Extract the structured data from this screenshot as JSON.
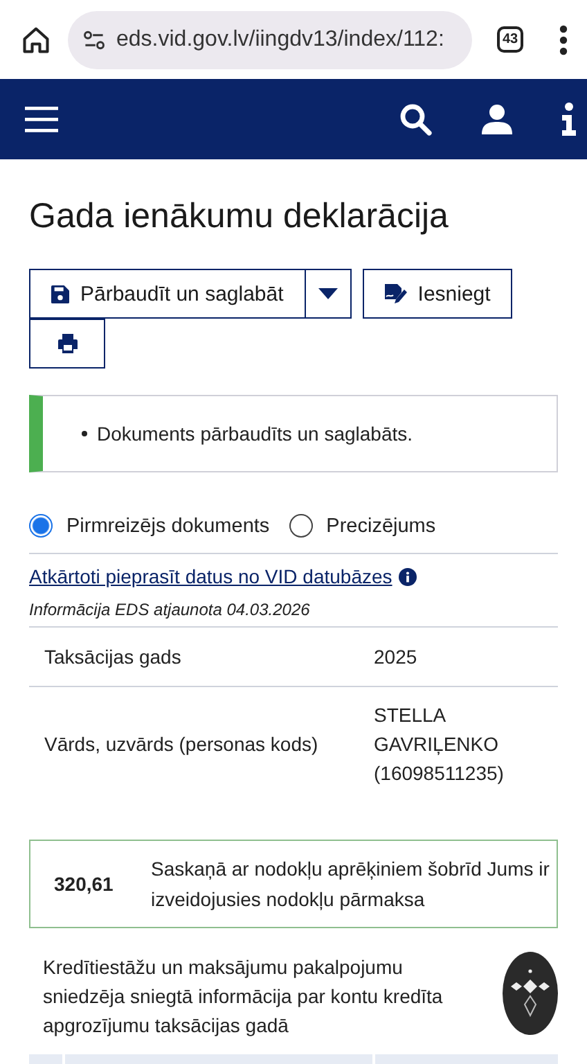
{
  "browser": {
    "url": "eds.vid.gov.lv/iingdv13/index/112:",
    "tab_count": "43"
  },
  "page_title": "Gada ienākumu deklarācija",
  "actions": {
    "save_label": "Pārbaudīt un saglabāt",
    "submit_label": "Iesniegt"
  },
  "message": {
    "kind": "success",
    "items": [
      "Dokuments pārbaudīts un saglabāts."
    ]
  },
  "document_type": [
    {
      "label": "Pirmreizējs dokuments",
      "selected": true
    },
    {
      "label": "Precizējums",
      "selected": false
    }
  ],
  "refresh_link": "Atkārtoti pieprasīt datus no VID datubāzes",
  "updated_note": "Informācija EDS atjaunota 04.03.2026",
  "details": [
    {
      "label": "Taksācijas gads",
      "value": "2025"
    },
    {
      "label": "Vārds, uzvārds (personas kods)",
      "value": "STELLA GAVRIĻENKO (16098511235)"
    }
  ],
  "result": {
    "amount": "320,61",
    "text": "Saskaņā ar nodokļu aprēķiniem šobrīd Jums ir izveidojusies nodokļu pārmaksa"
  },
  "section_heading": "Kredītiestāžu un maksājumu pakalpojumu sniedzēja sniegtā informācija par kontu kredīta apgrozījumu taksācijas gadā"
}
